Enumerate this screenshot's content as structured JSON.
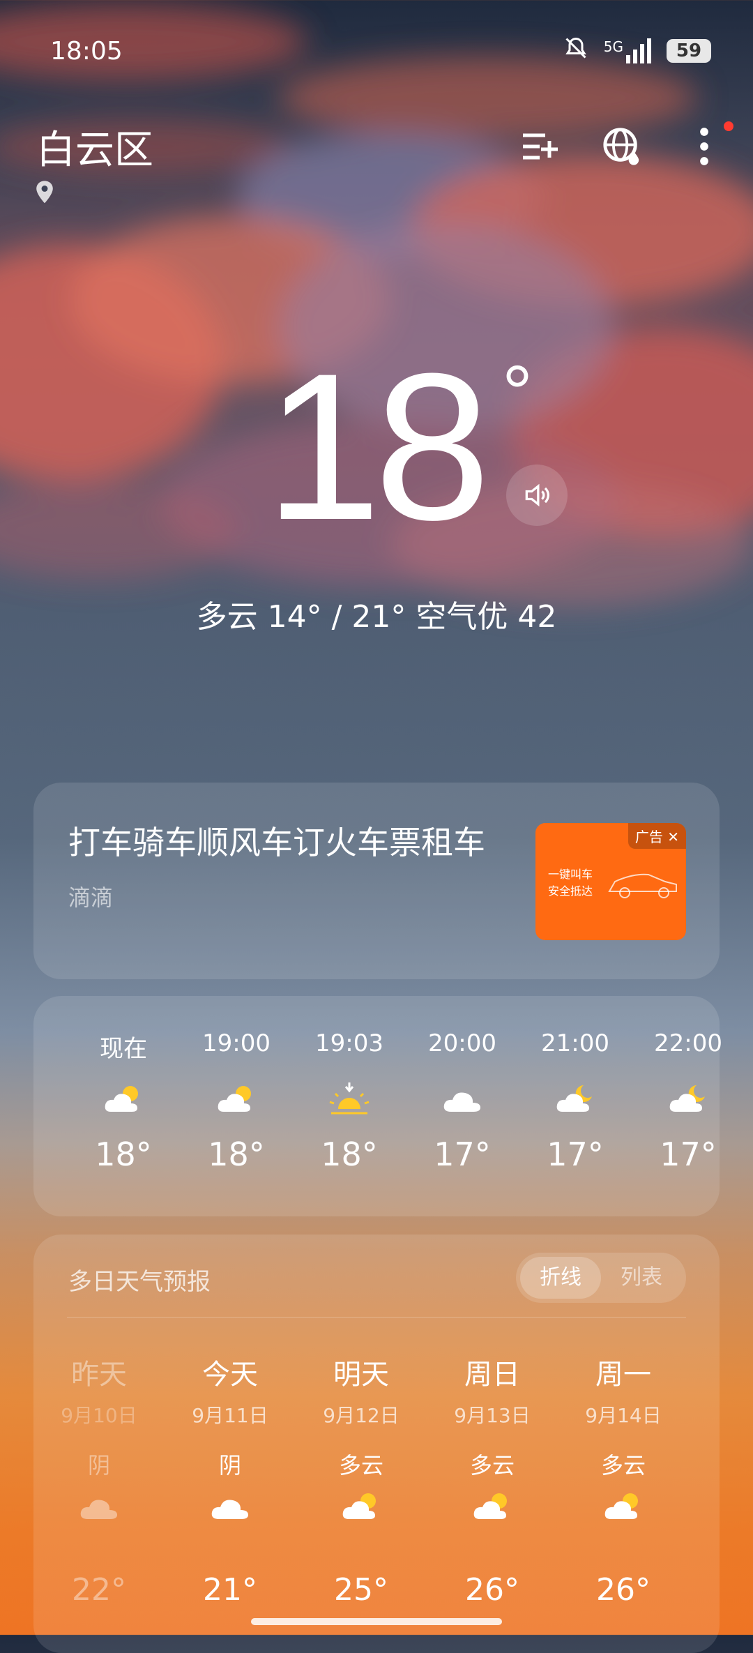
{
  "status_bar": {
    "time": "18:05",
    "network": "5G",
    "battery": "59"
  },
  "header": {
    "city": "白云区"
  },
  "current": {
    "temperature": "18",
    "degree_symbol": "°",
    "summary": "多云  14° / 21°  空气优 42"
  },
  "ad": {
    "title": "打车骑车顺风车订火车票租车",
    "brand": "滴滴",
    "tag": "广告",
    "slogan_line1": "一键叫车",
    "slogan_line2": "安全抵达"
  },
  "hourly": [
    {
      "time": "现在",
      "temp": "18°",
      "icon": "partly-cloudy-day-icon"
    },
    {
      "time": "19:00",
      "temp": "18°",
      "icon": "partly-cloudy-day-icon"
    },
    {
      "time": "19:03",
      "temp": "18°",
      "icon": "sunset-icon"
    },
    {
      "time": "20:00",
      "temp": "17°",
      "icon": "cloud-icon"
    },
    {
      "time": "21:00",
      "temp": "17°",
      "icon": "partly-cloudy-night-icon"
    },
    {
      "time": "22:00",
      "temp": "17°",
      "icon": "partly-cloudy-night-icon"
    }
  ],
  "daily": {
    "title": "多日天气预报",
    "toggle": {
      "line": "折线",
      "list": "列表"
    },
    "days": [
      {
        "name": "昨天",
        "date": "9月10日",
        "condition": "阴",
        "high": "22°",
        "icon": "cloud-icon"
      },
      {
        "name": "今天",
        "date": "9月11日",
        "condition": "阴",
        "high": "21°",
        "icon": "cloud-icon"
      },
      {
        "name": "明天",
        "date": "9月12日",
        "condition": "多云",
        "high": "25°",
        "icon": "partly-cloudy-day-icon"
      },
      {
        "name": "周日",
        "date": "9月13日",
        "condition": "多云",
        "high": "26°",
        "icon": "partly-cloudy-day-icon"
      },
      {
        "name": "周一",
        "date": "9月14日",
        "condition": "多云",
        "high": "26°",
        "icon": "partly-cloudy-day-icon"
      }
    ]
  },
  "colors": {
    "sun": "#ffc928",
    "ad_orange": "#ff6a12",
    "badge_red": "#ff3b30"
  }
}
